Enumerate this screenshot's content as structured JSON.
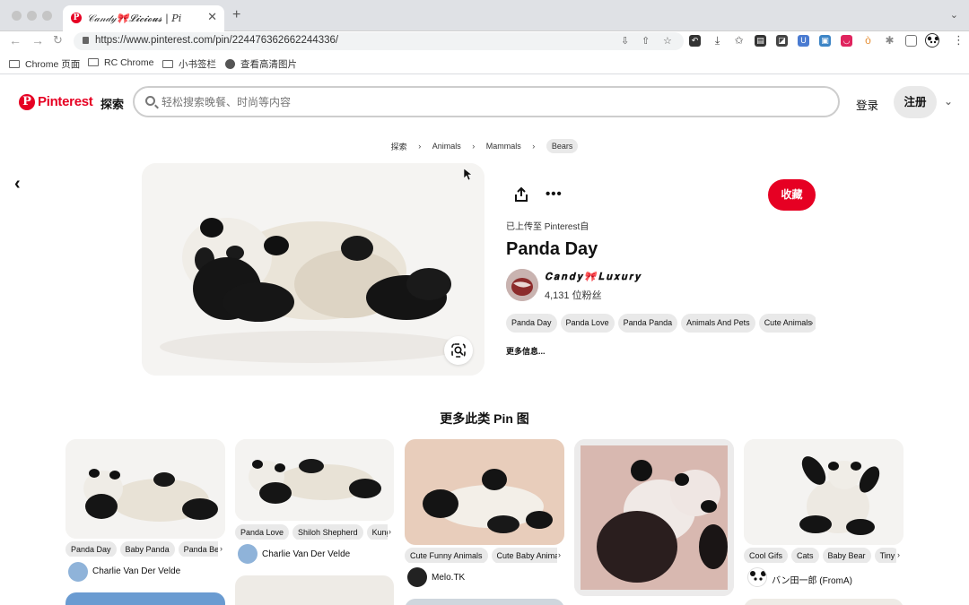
{
  "browser": {
    "tab_title": "𝒞𝒶𝓃𝒹𝓎🎀𝓛𝓲𝓬𝓲𝓸𝓾𝓼 | Pi",
    "url": "https://www.pinterest.com/pin/224476362662244336/",
    "bookmarks": [
      "Chrome 页面",
      "RC Chrome",
      "小书签栏",
      "查看高清图片"
    ]
  },
  "header": {
    "logo_text": "Pinterest",
    "explore": "探索",
    "search_placeholder": "轻松搜索晚餐、时尚等内容",
    "login": "登录",
    "signup": "注册"
  },
  "breadcrumb": [
    "探索",
    "Animals",
    "Mammals",
    "Bears"
  ],
  "pin": {
    "save_label": "收藏",
    "uploaded": "已上传至 Pinterest自",
    "title": "Panda Day",
    "author": "𝐂𝐚𝐧𝐝𝐲🎀𝐋𝐮𝐱𝐮𝐫𝐲",
    "followers": "4,131 位粉丝",
    "tags": [
      "Panda Day",
      "Panda Love",
      "Panda Panda",
      "Animals And Pets",
      "Cute Animals"
    ],
    "more_info": "更多信息..."
  },
  "more_like_title": "更多此类 Pin 图",
  "cards": [
    {
      "tags": [
        "Panda Day",
        "Baby Panda",
        "Panda Bear"
      ],
      "author": "Charlie Van Der Velde"
    },
    {
      "tags": [
        "Panda Love",
        "Shiloh Shepherd",
        "Kung Fu"
      ],
      "author": "Charlie Van Der Velde"
    },
    {
      "tags": [
        "Cute Funny Animals",
        "Cute Baby Animals"
      ],
      "author": "Melo.TK"
    },
    {
      "tags": [],
      "author": ""
    },
    {
      "tags": [
        "Cool Gifs",
        "Cats",
        "Baby Bear",
        "Tiny"
      ],
      "author": "バン田一郎 (FromA)"
    }
  ],
  "colors": {
    "brand": "#e60023",
    "chip": "#e9e9e9"
  }
}
